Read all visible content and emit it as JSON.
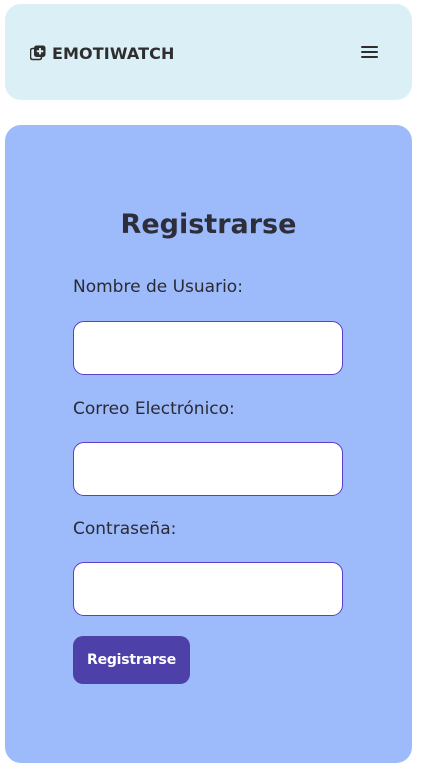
{
  "header": {
    "brand_name": "EMOTIWATCH",
    "brand_icon": "plus-square-icon",
    "menu_icon": "hamburger-menu-icon"
  },
  "form": {
    "title": "Registrarse",
    "fields": [
      {
        "label": "Nombre de Usuario:",
        "value": "",
        "placeholder": ""
      },
      {
        "label": "Correo Electrónico:",
        "value": "",
        "placeholder": ""
      },
      {
        "label": "Contraseña:",
        "value": "",
        "placeholder": ""
      }
    ],
    "submit_label": "Registrarse"
  },
  "colors": {
    "header_bg": "#dbeff7",
    "card_bg": "#9dbafa",
    "button_bg": "#4d40a8",
    "input_border": "#5b3fc8"
  }
}
